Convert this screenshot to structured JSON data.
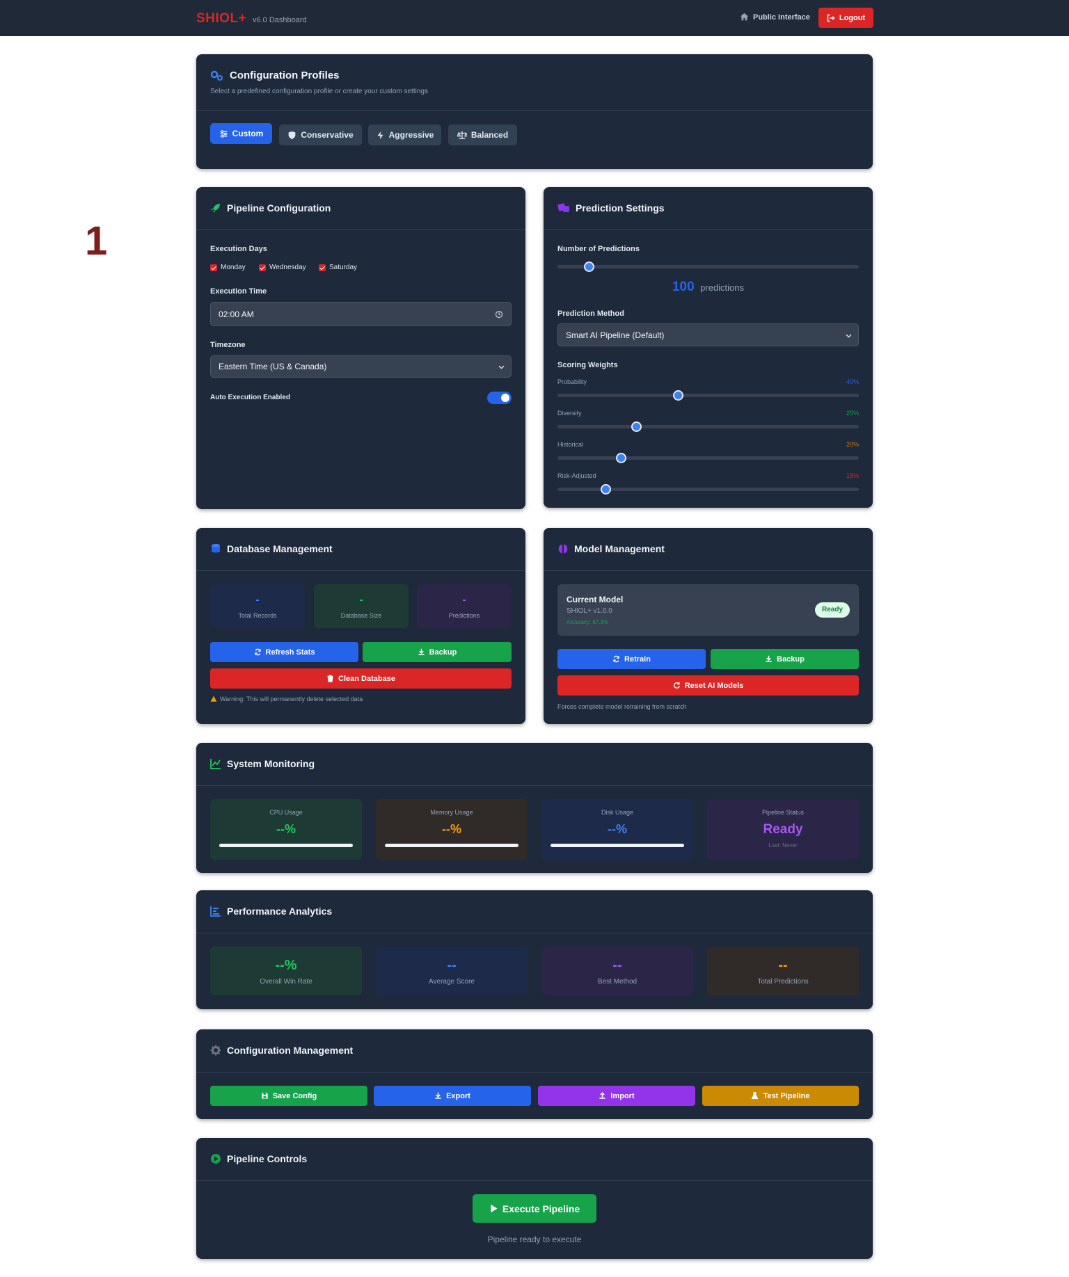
{
  "nav": {
    "brand": "SHIOL+",
    "version": "v6.0 Dashboard",
    "public_link": "Public Interface",
    "logout": "Logout"
  },
  "step_number": "1",
  "profiles": {
    "title": "Configuration Profiles",
    "subtitle": "Select a predefined configuration profile or create your custom settings",
    "buttons": [
      {
        "label": "Custom",
        "active": true
      },
      {
        "label": "Conservative",
        "active": false
      },
      {
        "label": "Aggressive",
        "active": false
      },
      {
        "label": "Balanced",
        "active": false
      }
    ]
  },
  "pipeline_config": {
    "title": "Pipeline Configuration",
    "execution_days_label": "Execution Days",
    "days": [
      "Monday",
      "Wednesday",
      "Saturday"
    ],
    "execution_time_label": "Execution Time",
    "execution_time": "02:00 AM",
    "timezone_label": "Timezone",
    "timezone": "Eastern Time (US & Canada)",
    "auto_execution_label": "Auto Execution Enabled",
    "auto_execution": true
  },
  "prediction_settings": {
    "title": "Prediction Settings",
    "num_predictions_label": "Number of Predictions",
    "num_predictions": "100",
    "num_predictions_unit": "predictions",
    "num_predictions_fraction": 0.105,
    "method_label": "Prediction Method",
    "method": "Smart AI Pipeline (Default)",
    "weights_label": "Scoring Weights",
    "weights": [
      {
        "name": "Probability",
        "value": "40%",
        "fraction": 0.4,
        "color": "#2563eb"
      },
      {
        "name": "Diversity",
        "value": "25%",
        "fraction": 0.26,
        "color": "#16a34a"
      },
      {
        "name": "Historical",
        "value": "20%",
        "fraction": 0.21,
        "color": "#d97706"
      },
      {
        "name": "Risk-Adjusted",
        "value": "15%",
        "fraction": 0.16,
        "color": "#dc2626"
      }
    ]
  },
  "database": {
    "title": "Database Management",
    "stats": [
      {
        "value": "-",
        "label": "Total Records",
        "color": "#3b82f6"
      },
      {
        "value": "-",
        "label": "Database Size",
        "color": "#22c55e"
      },
      {
        "value": "-",
        "label": "Predictions",
        "color": "#a855f7"
      }
    ],
    "refresh": "Refresh Stats",
    "backup": "Backup",
    "clean": "Clean Database",
    "warning": "Warning: This will permanently delete selected data"
  },
  "model": {
    "title": "Model Management",
    "current_label": "Current Model",
    "version": "SHIOL+ v1.0.0",
    "accuracy": "Accuracy: 87.3%",
    "status": "Ready",
    "retrain": "Retrain",
    "backup": "Backup",
    "reset": "Reset AI Models",
    "note": "Forces complete model retraining from scratch"
  },
  "monitoring": {
    "title": "System Monitoring",
    "items": [
      {
        "label": "CPU Usage",
        "value": "--%",
        "color": "#22c55e",
        "bg": "#1e3a34"
      },
      {
        "label": "Memory Usage",
        "value": "--%",
        "color": "#f59e0b",
        "bg": "#302a28"
      },
      {
        "label": "Disk Usage",
        "value": "--%",
        "color": "#3b82f6",
        "bg": "#1e2a4a"
      }
    ],
    "pipeline_label": "Pipeline Status",
    "pipeline_value": "Ready",
    "pipeline_last": "Last: Never"
  },
  "analytics": {
    "title": "Performance Analytics",
    "items": [
      {
        "value": "--%",
        "label": "Overall Win Rate",
        "color": "#22c55e",
        "bg": "#1e3a34"
      },
      {
        "value": "--",
        "label": "Average Score",
        "color": "#3b82f6",
        "bg": "#1e2a4a"
      },
      {
        "value": "--",
        "label": "Best Method",
        "color": "#a855f7",
        "bg": "#2b2548"
      },
      {
        "value": "--",
        "label": "Total Predictions",
        "color": "#f59e0b",
        "bg": "#302a28"
      }
    ]
  },
  "config_mgmt": {
    "title": "Configuration Management",
    "save": "Save Config",
    "export": "Export",
    "import": "Import",
    "test": "Test Pipeline"
  },
  "controls": {
    "title": "Pipeline Controls",
    "execute": "Execute Pipeline",
    "status": "Pipeline ready to execute"
  }
}
